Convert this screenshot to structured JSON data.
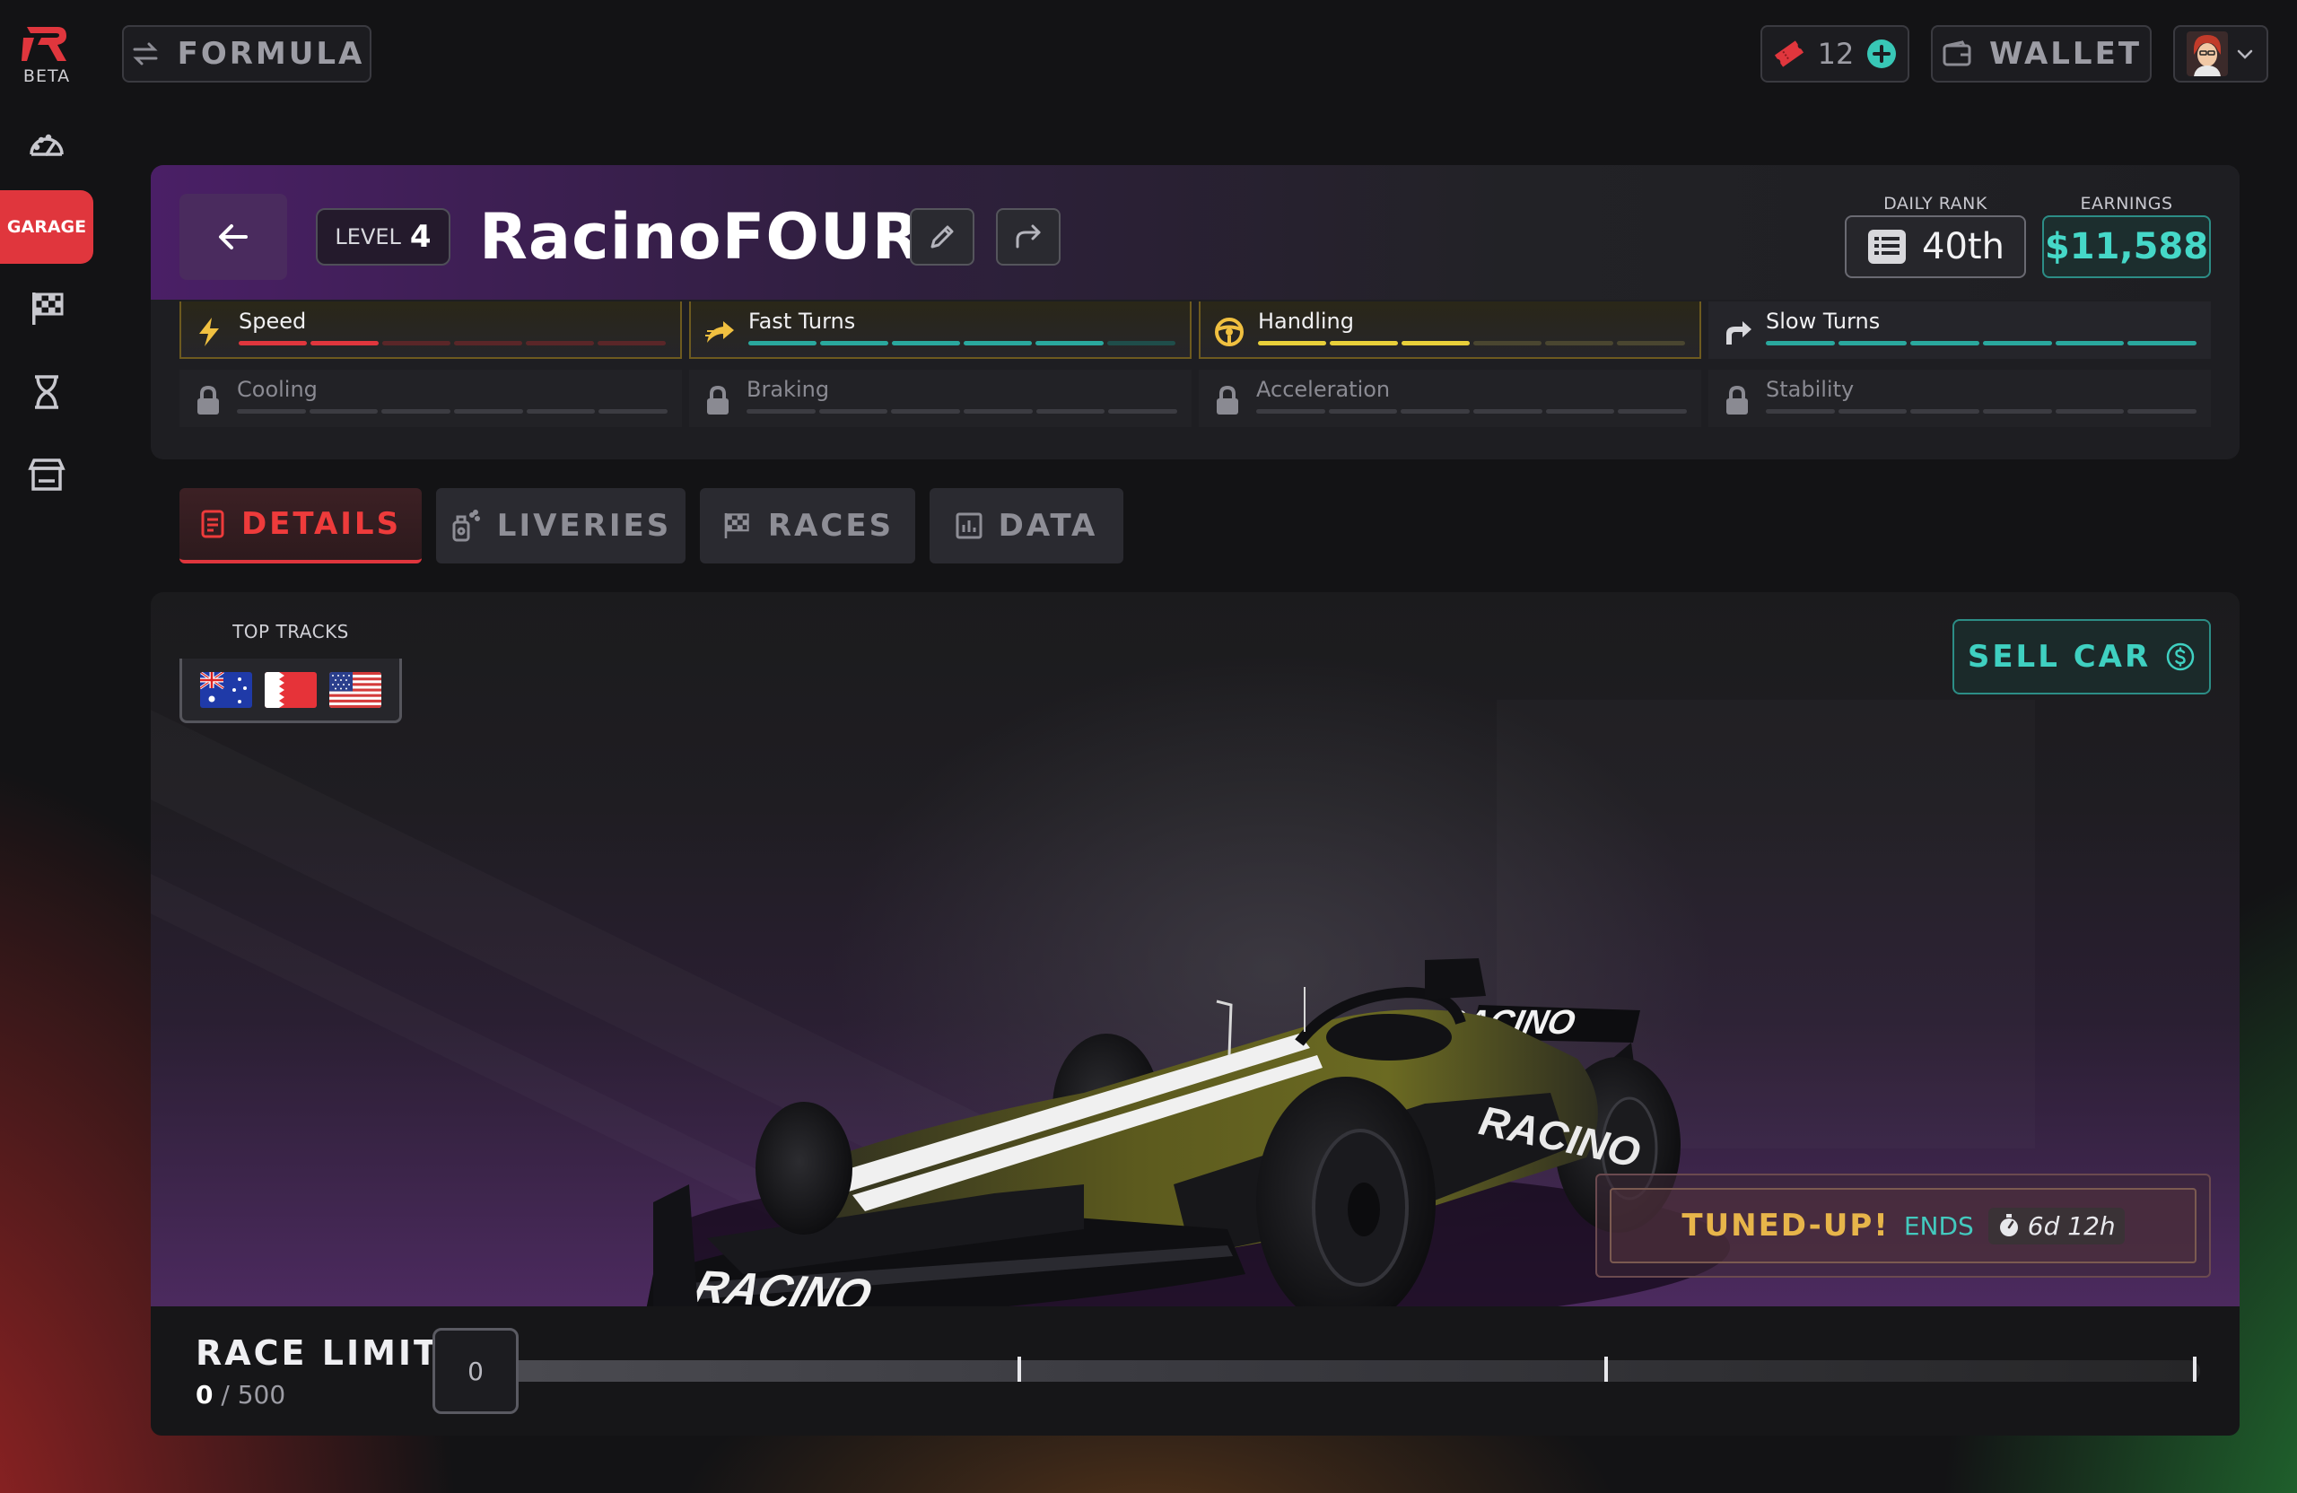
{
  "app": {
    "logo_badge": "BETA"
  },
  "sidebar": {
    "items": [
      {
        "id": "dashboard",
        "icon": "speedometer-icon",
        "label": ""
      },
      {
        "id": "garage",
        "icon": "garage-icon",
        "label": "GARAGE",
        "active": true
      },
      {
        "id": "races",
        "icon": "checkered-flag-icon",
        "label": ""
      },
      {
        "id": "timers",
        "icon": "hourglass-icon",
        "label": ""
      },
      {
        "id": "shop",
        "icon": "store-icon",
        "label": ""
      }
    ]
  },
  "topbar": {
    "mode_label": "FORMULA",
    "tickets_count": "12",
    "wallet_label": "WALLET"
  },
  "car": {
    "level_label": "LEVEL",
    "level_value": "4",
    "name": "RacinoFOUR",
    "daily_rank_label": "DAILY RANK",
    "daily_rank_value": "40th",
    "earnings_label": "EARNINGS",
    "earnings_value": "$11,588"
  },
  "stats": {
    "unlocked": [
      {
        "name": "Speed",
        "icon": "lightning-icon",
        "filled": 2,
        "total": 6,
        "color": "#e0363d",
        "highlight": true
      },
      {
        "name": "Fast Turns",
        "icon": "fast-turn-icon",
        "filled": 5,
        "total": 6,
        "color": "#2aa89e",
        "highlight": true
      },
      {
        "name": "Handling",
        "icon": "steering-wheel-icon",
        "filled": 3,
        "total": 6,
        "color": "#e8cf3a",
        "highlight": true
      },
      {
        "name": "Slow Turns",
        "icon": "turn-arrow-icon",
        "filled": 6,
        "total": 6,
        "color": "#2aa89e",
        "highlight": false
      }
    ],
    "locked": [
      {
        "name": "Cooling"
      },
      {
        "name": "Braking"
      },
      {
        "name": "Acceleration"
      },
      {
        "name": "Stability"
      }
    ]
  },
  "tabs": [
    {
      "label": "DETAILS",
      "icon": "document-icon",
      "active": true
    },
    {
      "label": "LIVERIES",
      "icon": "spray-can-icon",
      "active": false
    },
    {
      "label": "RACES",
      "icon": "checkered-flag-icon",
      "active": false
    },
    {
      "label": "DATA",
      "icon": "bar-chart-icon",
      "active": false
    }
  ],
  "showcase": {
    "top_tracks_label": "TOP TRACKS",
    "top_tracks": [
      "Australia",
      "Bahrain",
      "United States"
    ],
    "sell_label": "SELL CAR",
    "car_livery_text": "RACINO",
    "tuned_label": "TUNED-UP!",
    "ends_label": "ENDS",
    "ends_value": "6d 12h"
  },
  "race_limit": {
    "title": "RACE LIMIT",
    "current": "0",
    "separator": "/",
    "max": "500",
    "box_value": "0",
    "progress_fraction": 0
  },
  "colors": {
    "accent_red": "#e0363d",
    "accent_teal": "#3fd0c1",
    "accent_gold": "#e7b54a",
    "card_purple": "#4a1f66"
  }
}
